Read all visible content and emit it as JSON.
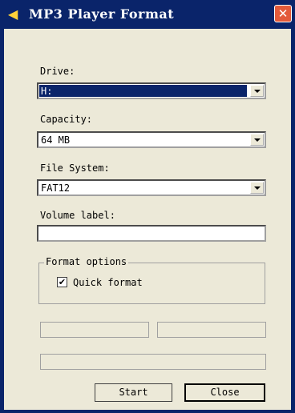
{
  "window": {
    "title": "MP3 Player Format",
    "title_icon": "speaker-icon",
    "close_glyph": "✕"
  },
  "drive": {
    "label": "Drive:",
    "value": "H:"
  },
  "capacity": {
    "label": "Capacity:",
    "value": "64 MB"
  },
  "file_system": {
    "label": "File System:",
    "value": "FAT12"
  },
  "volume_label": {
    "label": "Volume label:",
    "value": ""
  },
  "format_options": {
    "title": "Format options",
    "quick_format_label": "Quick format",
    "quick_format_checked": true,
    "check_glyph": "✔"
  },
  "buttons": {
    "start": "Start",
    "close": "Close"
  },
  "colors": {
    "titlebar": "#0a246a",
    "client": "#ece9d8",
    "selection": "#0a246a",
    "close_button": "#e35a3a"
  }
}
